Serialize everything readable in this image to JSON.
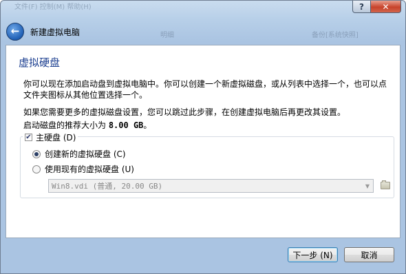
{
  "window": {
    "help_label": "?",
    "close_label": "✕",
    "header_title": "新建虚拟电脑"
  },
  "background": {
    "ghost_top": "文件(F)  控制(M)  帮助(H)",
    "ghost_tab1": "明细",
    "ghost_tab2": "备份[系统快照]"
  },
  "page": {
    "title": "虚拟硬盘",
    "para1": "你可以现在添加启动盘到虚拟电脑中。你可以创建一个新虚拟磁盘，或从列表中选择一个，也可以点文件夹图标从其他位置选择一个。",
    "para2": "如果您需要更多的虚拟磁盘设置，您可以跳过此步骤，在创建虚拟电脑后再更改其设置。",
    "para3_prefix": "启动磁盘的推荐大小为 ",
    "para3_size": "8.00 GB",
    "para3_suffix": "。"
  },
  "group": {
    "checkbox_label": "主硬盘 (D)",
    "checkbox_checked": true,
    "radio_create_label": "创建新的虚拟硬盘 (C)",
    "radio_existing_label": "使用现有的虚拟硬盘 (U)",
    "selected": "create",
    "combo_value": "Win8.vdi (普通, 20.00 GB)",
    "combo_arrow": "▼",
    "folder_icon": "folder-icon"
  },
  "footer": {
    "next_label": "下一步 (N)",
    "cancel_label": "取消"
  }
}
